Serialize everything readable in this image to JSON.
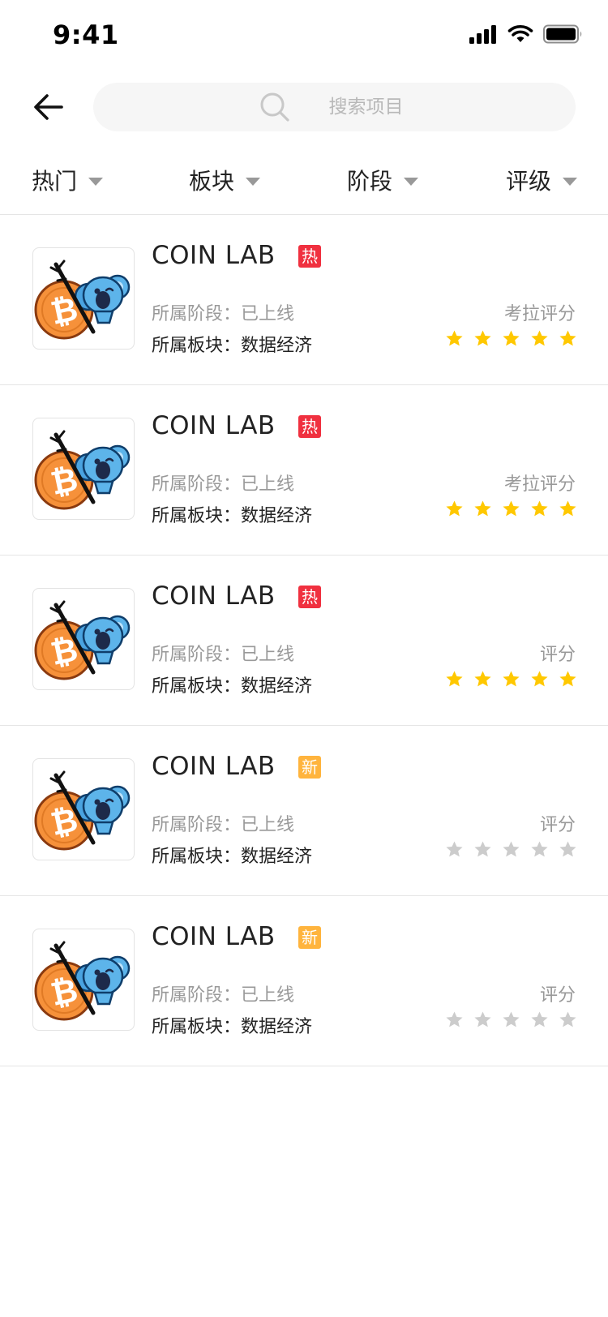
{
  "status_bar": {
    "time": "9:41",
    "icons": [
      "signal-icon",
      "wifi-icon",
      "battery-icon"
    ]
  },
  "header": {
    "back_icon": "back-arrow-icon",
    "search": {
      "icon": "search-icon",
      "placeholder": "搜索项目"
    }
  },
  "filters": [
    {
      "label": "热门"
    },
    {
      "label": "板块"
    },
    {
      "label": "阶段"
    },
    {
      "label": "评级"
    }
  ],
  "colors": {
    "hot_tag": "#f0303f",
    "new_tag": "#ffb43d",
    "star_filled": "#ffc800",
    "star_empty": "#cccccc",
    "muted_text": "#999999"
  },
  "projects": [
    {
      "title": "COIN LAB",
      "tag": "热",
      "tag_type": "hot",
      "stage": "所属阶段：已上线",
      "sector": "所属板块：数据经济",
      "rating_label": "考拉评分",
      "stars": 5
    },
    {
      "title": "COIN LAB",
      "tag": "热",
      "tag_type": "hot",
      "stage": "所属阶段：已上线",
      "sector": "所属板块：数据经济",
      "rating_label": "考拉评分",
      "stars": 5
    },
    {
      "title": "COIN LAB",
      "tag": "热",
      "tag_type": "hot",
      "stage": "所属阶段：已上线",
      "sector": "所属板块：数据经济",
      "rating_label": "评分",
      "stars": 5
    },
    {
      "title": "COIN LAB",
      "tag": "新",
      "tag_type": "new",
      "stage": "所属阶段：已上线",
      "sector": "所属板块：数据经济",
      "rating_label": "评分",
      "stars": 0
    },
    {
      "title": "COIN LAB",
      "tag": "新",
      "tag_type": "new",
      "stage": "所属阶段：已上线",
      "sector": "所属板块：数据经济",
      "rating_label": "评分",
      "stars": 0
    }
  ]
}
